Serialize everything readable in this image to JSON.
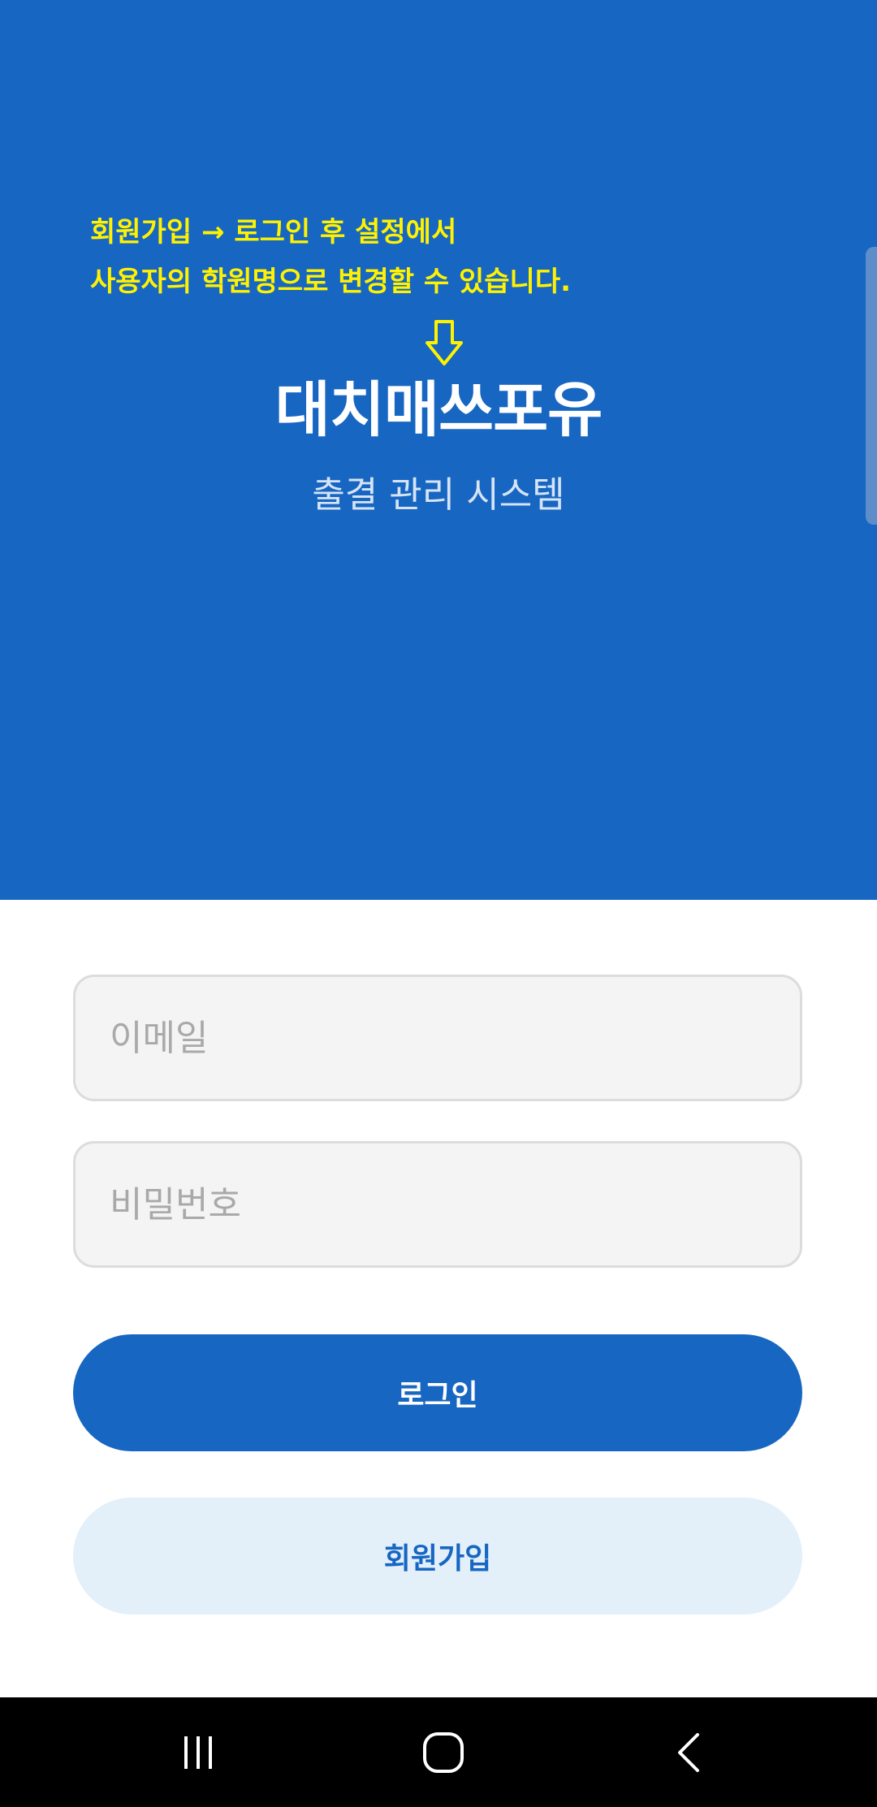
{
  "header": {
    "annotation_line1_before": "회원가입",
    "annotation_arrow": "→",
    "annotation_line1_after": "로그인 후 설정에서",
    "annotation_line2": "사용자의 학원명으로 변경할 수 있습니다.",
    "annotation_color": "#FFF200",
    "app_title": "대치매쓰포유",
    "app_subtitle": "출결 관리 시스템",
    "background_color": "#1766C2"
  },
  "form": {
    "email_placeholder": "이메일",
    "email_value": "",
    "password_placeholder": "비밀번호",
    "password_value": "",
    "login_label": "로그인",
    "signup_label": "회원가입",
    "primary_color": "#1766C2",
    "secondary_color": "#E3F0FA"
  },
  "navbar": {
    "icons": [
      "recent-apps-icon",
      "home-icon",
      "back-icon"
    ]
  }
}
